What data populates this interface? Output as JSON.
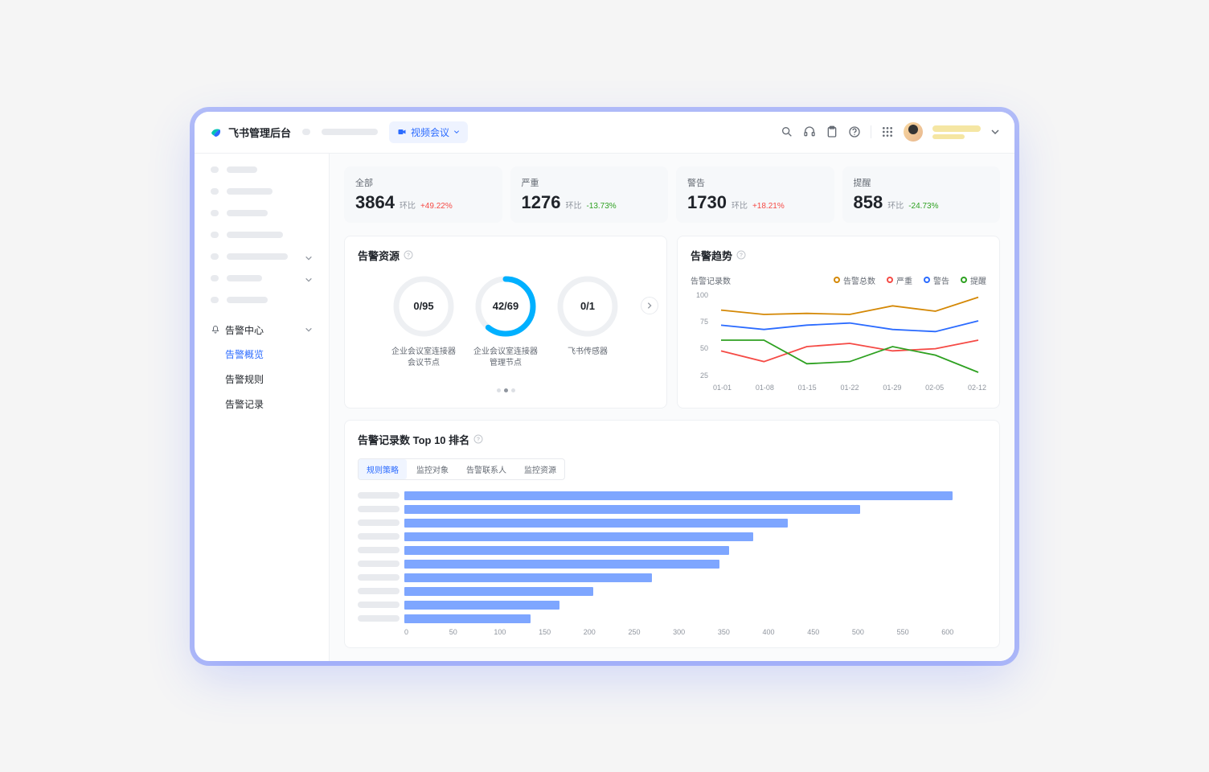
{
  "header": {
    "brand": "飞书管理后台",
    "breadcrumb_pill": "视频会议"
  },
  "sidebar": {
    "section_label": "告警中心",
    "items": [
      {
        "label": "告警概览",
        "active": true
      },
      {
        "label": "告警规则",
        "active": false
      },
      {
        "label": "告警记录",
        "active": false
      }
    ]
  },
  "kpis": {
    "ratio_label": "环比",
    "cards": [
      {
        "label": "全部",
        "value": "3864",
        "pct": "+49.22%",
        "dir": "up"
      },
      {
        "label": "严重",
        "value": "1276",
        "pct": "-13.73%",
        "dir": "dn"
      },
      {
        "label": "警告",
        "value": "1730",
        "pct": "+18.21%",
        "dir": "up"
      },
      {
        "label": "提醒",
        "value": "858",
        "pct": "-24.73%",
        "dir": "dn"
      }
    ]
  },
  "resource_panel": {
    "title": "告警资源",
    "rings": [
      {
        "text": "0/95",
        "used": 0,
        "total": 95,
        "label_l1": "企业会议室连接器",
        "label_l2": "会议节点"
      },
      {
        "text": "42/69",
        "used": 42,
        "total": 69,
        "label_l1": "企业会议室连接器",
        "label_l2": "管理节点"
      },
      {
        "text": "0/1",
        "used": 0,
        "total": 1,
        "label_l1": "飞书传感器",
        "label_l2": ""
      }
    ]
  },
  "trend_panel": {
    "title": "告警趋势",
    "y_title": "告警记录数",
    "legend": [
      {
        "label": "告警总数",
        "color": "#d48806"
      },
      {
        "label": "严重",
        "color": "#f54a45"
      },
      {
        "label": "警告",
        "color": "#2b6bff"
      },
      {
        "label": "提醒",
        "color": "#2ea121"
      }
    ]
  },
  "top10_panel": {
    "title": "告警记录数 Top 10 排名",
    "tabs": [
      "规则策略",
      "监控对象",
      "告警联系人",
      "监控资源"
    ],
    "tab_active": 0
  },
  "chart_data": [
    {
      "type": "line",
      "x": [
        "01-01",
        "01-08",
        "01-15",
        "01-22",
        "01-29",
        "02-05",
        "02-12"
      ],
      "ylim": [
        25,
        100
      ],
      "yticks": [
        25,
        50,
        75,
        100
      ],
      "series": [
        {
          "name": "告警总数",
          "color": "#d48806",
          "values": [
            86,
            82,
            83,
            82,
            90,
            85,
            98
          ]
        },
        {
          "name": "严重",
          "color": "#f54a45",
          "values": [
            48,
            38,
            52,
            55,
            48,
            50,
            58
          ]
        },
        {
          "name": "警告",
          "color": "#2b6bff",
          "values": [
            72,
            68,
            72,
            74,
            68,
            66,
            76
          ]
        },
        {
          "name": "提醒",
          "color": "#2ea121",
          "values": [
            58,
            58,
            36,
            38,
            52,
            44,
            28
          ]
        }
      ]
    },
    {
      "type": "bar",
      "xlim": [
        0,
        600
      ],
      "xticks": [
        0,
        50,
        100,
        150,
        200,
        250,
        300,
        350,
        400,
        450,
        500,
        550,
        600
      ],
      "values": [
        565,
        470,
        395,
        360,
        335,
        325,
        255,
        195,
        160,
        130
      ]
    }
  ]
}
